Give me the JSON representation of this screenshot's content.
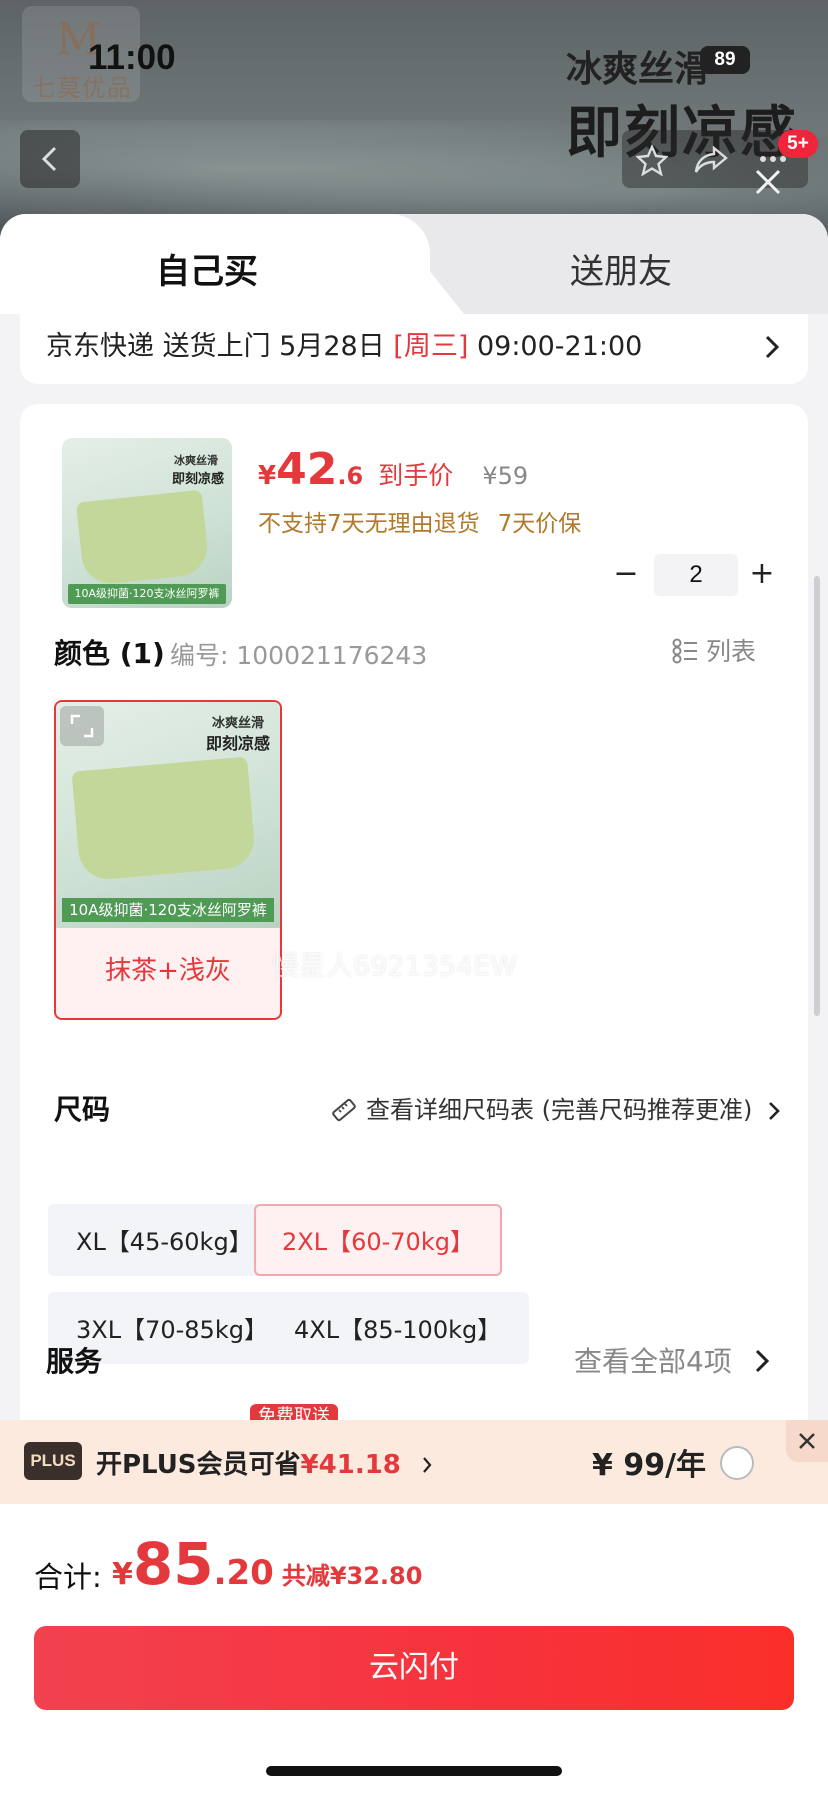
{
  "status_bar": {
    "time": "11:00",
    "battery": "89"
  },
  "backdrop": {
    "brand_initial": "M",
    "brand_sub": "七莫优品",
    "promo_line1": "冰爽丝滑",
    "promo_line2": "即刻凉感",
    "cart_badge": "5+"
  },
  "tabs": [
    {
      "label": "自己买",
      "active": true
    },
    {
      "label": "送朋友",
      "active": false
    }
  ],
  "delivery": {
    "carrier": "京东快递 送货上门 5月28日 ",
    "weekday": "[周三]",
    "window": " 09:00-21:00"
  },
  "product": {
    "thumb_top": "冰爽丝滑",
    "thumb_title": "即刻凉感",
    "thumb_stripe": "10A级抑菌·120支冰丝阿罗裤",
    "price_yen": "¥",
    "price_int": "42",
    "price_dec": ".6",
    "price_tag": "到手价",
    "price_orig": "¥59",
    "note_no_return": "不支持7天无理由退货",
    "note_price_protect": "7天价保",
    "qty": "2",
    "qty_minus": "−",
    "qty_plus": "+"
  },
  "color": {
    "heading": "颜色 (1)",
    "sku": "编号: 100021176243",
    "list_label": "列表",
    "option_label": "抹茶+浅灰",
    "option_top": "冰爽丝滑",
    "option_title": "即刻凉感",
    "option_stripe": "10A级抑菌·120支冰丝阿罗裤"
  },
  "watermark": "慢星人6921354EW",
  "size": {
    "heading": "尺码",
    "guide": "查看详细尺码表 (完善尺码推荐更准)",
    "options": [
      {
        "label": "XL【45-60kg】",
        "selected": false
      },
      {
        "label": "2XL【60-70kg】",
        "selected": true
      },
      {
        "label": "3XL【70-85kg】",
        "selected": false
      },
      {
        "label": "4XL【85-100kg】",
        "selected": false
      }
    ]
  },
  "service": {
    "heading": "服务",
    "more": "查看全部4项",
    "free_tag": "免费取送"
  },
  "plus": {
    "logo": "PLUS",
    "text": "开PLUS会员可省",
    "amount": "¥41.18",
    "price": "¥ 99/年"
  },
  "total": {
    "label": "合计:",
    "yen": "¥",
    "int": "85",
    "dec": ".20",
    "save": "共减¥32.80"
  },
  "pay_button": "云闪付",
  "colors": {
    "accent": "#e4393c",
    "plus_bg": "#fdeadf",
    "note": "#b07a2a"
  }
}
